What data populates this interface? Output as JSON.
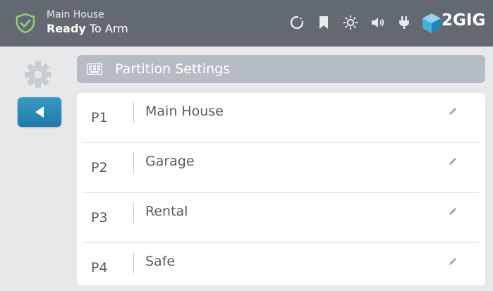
{
  "header": {
    "location": "Main House",
    "status_bold": "Ready",
    "status_rest": " To Arm",
    "icons": [
      "sync-icon",
      "bookmark-icon",
      "brightness-icon",
      "volume-icon",
      "power-plug-icon"
    ],
    "brand": "2GIG"
  },
  "section": {
    "title": "Partition Settings",
    "icon": "keypad-icon"
  },
  "partitions": [
    {
      "id": "P1",
      "name": "Main House"
    },
    {
      "id": "P2",
      "name": "Garage"
    },
    {
      "id": "P3",
      "name": "Rental"
    },
    {
      "id": "P4",
      "name": "Safe"
    }
  ],
  "colors": {
    "header_bg": "#626970",
    "accent": "#2a8bb8",
    "shield": "#8fd07a",
    "section_bg": "#b6bcc3"
  }
}
